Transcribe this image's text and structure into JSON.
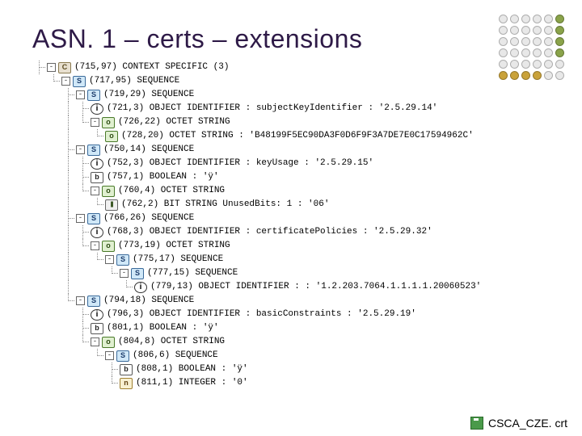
{
  "title": "ASN. 1 – certs – extensions",
  "footer_file": "CSCA_CZE. crt",
  "nodes": [
    {
      "depth": 0,
      "branch": "tee",
      "toggle": "-",
      "icon": "ctx",
      "iconChar": "C",
      "text": "(715,97) CONTEXT SPECIFIC (3)"
    },
    {
      "depth": 1,
      "branch": "end",
      "toggle": "-",
      "icon": "seq",
      "iconChar": "S",
      "text": "(717,95) SEQUENCE"
    },
    {
      "depth": 2,
      "branch": "tee",
      "toggle": "-",
      "icon": "seq",
      "iconChar": "S",
      "text": "(719,29) SEQUENCE"
    },
    {
      "depth": 3,
      "branch": "tee",
      "toggle": "",
      "icon": "oid",
      "iconChar": "i",
      "text": "(721,3) OBJECT IDENTIFIER : subjectKeyIdentifier : '2.5.29.14'"
    },
    {
      "depth": 3,
      "branch": "end",
      "toggle": "-",
      "icon": "oct",
      "iconChar": "o",
      "text": "(726,22) OCTET STRING"
    },
    {
      "depth": 4,
      "branch": "end",
      "toggle": "",
      "icon": "oct",
      "iconChar": "o",
      "text": "(728,20) OCTET STRING : 'B48199F5EC90DA3F0D6F9F3A7DE7E0C17594962C'"
    },
    {
      "depth": 2,
      "branch": "tee",
      "toggle": "-",
      "icon": "seq",
      "iconChar": "S",
      "text": "(750,14) SEQUENCE"
    },
    {
      "depth": 3,
      "branch": "tee",
      "toggle": "",
      "icon": "oid",
      "iconChar": "i",
      "text": "(752,3) OBJECT IDENTIFIER : keyUsage : '2.5.29.15'"
    },
    {
      "depth": 3,
      "branch": "tee",
      "toggle": "",
      "icon": "bool",
      "iconChar": "b",
      "text": "(757,1) BOOLEAN : 'ÿ'"
    },
    {
      "depth": 3,
      "branch": "end",
      "toggle": "-",
      "icon": "oct",
      "iconChar": "o",
      "text": "(760,4) OCTET STRING"
    },
    {
      "depth": 4,
      "branch": "end",
      "toggle": "",
      "icon": "bit",
      "iconChar": "|||",
      "text": "(762,2) BIT STRING UnusedBits: 1 : '06'"
    },
    {
      "depth": 2,
      "branch": "tee",
      "toggle": "-",
      "icon": "seq",
      "iconChar": "S",
      "text": "(766,26) SEQUENCE"
    },
    {
      "depth": 3,
      "branch": "tee",
      "toggle": "",
      "icon": "oid",
      "iconChar": "i",
      "text": "(768,3) OBJECT IDENTIFIER : certificatePolicies : '2.5.29.32'"
    },
    {
      "depth": 3,
      "branch": "end",
      "toggle": "-",
      "icon": "oct",
      "iconChar": "o",
      "text": "(773,19) OCTET STRING"
    },
    {
      "depth": 4,
      "branch": "end",
      "toggle": "-",
      "icon": "seq",
      "iconChar": "S",
      "text": "(775,17) SEQUENCE"
    },
    {
      "depth": 5,
      "branch": "end",
      "toggle": "-",
      "icon": "seq",
      "iconChar": "S",
      "text": "(777,15) SEQUENCE"
    },
    {
      "depth": 6,
      "branch": "end",
      "toggle": "",
      "icon": "oid",
      "iconChar": "i",
      "text": "(779,13) OBJECT IDENTIFIER :  : '1.2.203.7064.1.1.1.1.20060523'"
    },
    {
      "depth": 2,
      "branch": "end",
      "toggle": "-",
      "icon": "seq",
      "iconChar": "S",
      "text": "(794,18) SEQUENCE"
    },
    {
      "depth": 3,
      "branch": "tee",
      "toggle": "",
      "icon": "oid",
      "iconChar": "i",
      "text": "(796,3) OBJECT IDENTIFIER : basicConstraints : '2.5.29.19'"
    },
    {
      "depth": 3,
      "branch": "tee",
      "toggle": "",
      "icon": "bool",
      "iconChar": "b",
      "text": "(801,1) BOOLEAN : 'ÿ'"
    },
    {
      "depth": 3,
      "branch": "end",
      "toggle": "-",
      "icon": "oct",
      "iconChar": "o",
      "text": "(804,8) OCTET STRING"
    },
    {
      "depth": 4,
      "branch": "end",
      "toggle": "-",
      "icon": "seq",
      "iconChar": "S",
      "text": "(806,6) SEQUENCE"
    },
    {
      "depth": 5,
      "branch": "tee",
      "toggle": "",
      "icon": "bool",
      "iconChar": "b",
      "text": "(808,1) BOOLEAN : 'ÿ'"
    },
    {
      "depth": 5,
      "branch": "end",
      "toggle": "",
      "icon": "int",
      "iconChar": "n",
      "text": "(811,1) INTEGER : '0'"
    }
  ],
  "dot_colors": [
    "#e8e8e8",
    "#e8e8e8",
    "#e8e8e8",
    "#e8e8e8",
    "#e8e8e8",
    "#8aa34a",
    "#e8e8e8",
    "#e8e8e8",
    "#e8e8e8",
    "#e8e8e8",
    "#e8e8e8",
    "#8aa34a",
    "#e8e8e8",
    "#e8e8e8",
    "#e8e8e8",
    "#e8e8e8",
    "#e8e8e8",
    "#8aa34a",
    "#e8e8e8",
    "#e8e8e8",
    "#e8e8e8",
    "#e8e8e8",
    "#e8e8e8",
    "#8aa34a",
    "#e8e8e8",
    "#e8e8e8",
    "#e8e8e8",
    "#e8e8e8",
    "#e8e8e8",
    "#e8e8e8",
    "#c9a23a",
    "#c9a23a",
    "#c9a23a",
    "#c9a23a",
    "#e8e8e8",
    "#e8e8e8"
  ]
}
